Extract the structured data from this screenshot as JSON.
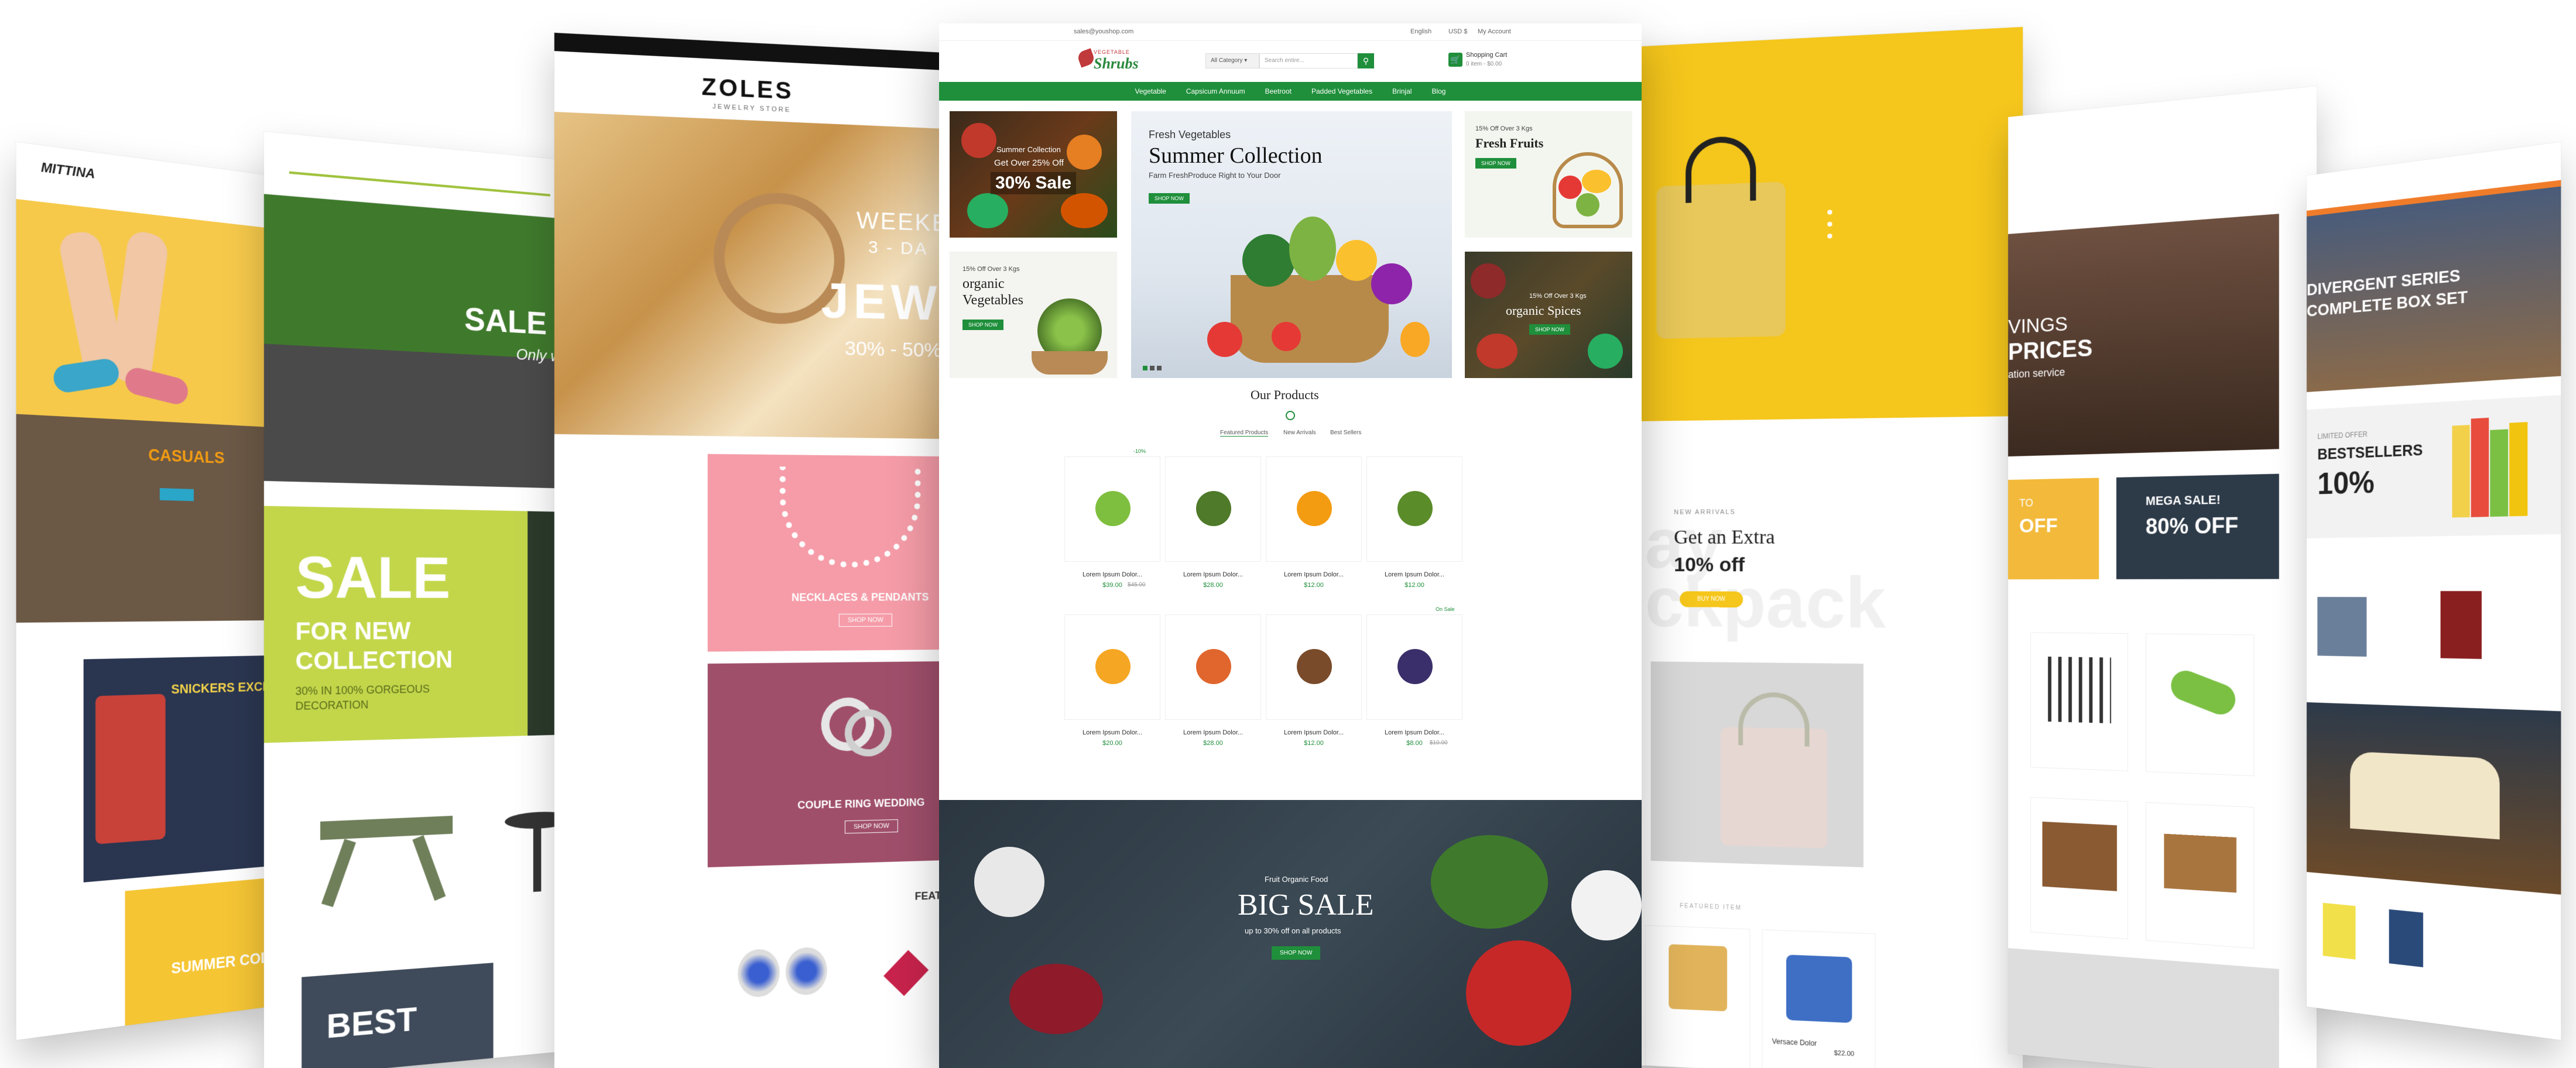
{
  "center": {
    "topbar": {
      "email": "sales@youshop.com",
      "language": "English",
      "currency": "USD $",
      "account": "My Account"
    },
    "logo": {
      "line1": "VEGETABLE",
      "line2": "Shrubs"
    },
    "search": {
      "category": "All Category",
      "placeholder": "Search entire..."
    },
    "cart": {
      "title": "Shopping Cart",
      "subtitle": "0 item - $0.00"
    },
    "nav": [
      "Vegetable",
      "Capsicum Annuum",
      "Beetroot",
      "Padded Vegetables",
      "Brinjal",
      "Blog"
    ],
    "promo_left_top": {
      "line1": "Summer Collection",
      "line2": "Get Over 25% Off",
      "line3": "30% Sale"
    },
    "promo_left_bottom": {
      "line1": "15% Off Over 3 Kgs",
      "line2": "organic",
      "line3": "Vegetables",
      "button": "SHOP NOW"
    },
    "hero": {
      "kicker": "Fresh Vegetables",
      "title": "Summer Collection",
      "subtitle": "Farm FreshProduce Right to Your Door",
      "button": "SHOP NOW"
    },
    "promo_right_top": {
      "line1": "15% Off Over 3 Kgs",
      "line2": "Fresh Fruits",
      "button": "SHOP NOW"
    },
    "promo_right_bottom": {
      "line1": "15% Off Over 3 Kgs",
      "line2": "organic Spices",
      "button": "SHOP NOW"
    },
    "products": {
      "title": "Our Products",
      "tabs": [
        "Featured Products",
        "New Arrivals",
        "Best Sellers"
      ],
      "items": [
        {
          "name": "Lorem Ipsum Dolor...",
          "price": "$39.00",
          "old": "$45.00",
          "badge": "-10%",
          "color": "#7fbf3f"
        },
        {
          "name": "Lorem Ipsum Dolor...",
          "price": "$28.00",
          "old": "",
          "badge": "",
          "color": "#4f7a2a"
        },
        {
          "name": "Lorem Ipsum Dolor...",
          "price": "$12.00",
          "old": "",
          "badge": "",
          "color": "#f39c12"
        },
        {
          "name": "Lorem Ipsum Dolor...",
          "price": "$12.00",
          "old": "",
          "badge": "",
          "color": "#5b8c2a"
        },
        {
          "name": "Lorem Ipsum Dolor...",
          "price": "$20.00",
          "old": "",
          "badge": "",
          "color": "#f5a623"
        },
        {
          "name": "Lorem Ipsum Dolor...",
          "price": "$28.00",
          "old": "",
          "badge": "",
          "color": "#e0662e"
        },
        {
          "name": "Lorem Ipsum Dolor...",
          "price": "$12.00",
          "old": "",
          "badge": "",
          "color": "#7a4b2a"
        },
        {
          "name": "Lorem Ipsum Dolor...",
          "price": "$8.00",
          "old": "$10.00",
          "badge": "On Sale",
          "color": "#3b2f6b"
        }
      ]
    },
    "banner": {
      "kicker": "Fruit Organic Food",
      "title": "BIG SALE",
      "subtitle": "up to 30% off on all products",
      "button": "SHOP NOW"
    }
  },
  "p1": {
    "logo": "MITTINA",
    "promo": "CASUALS",
    "promo2": "SNICKERS EXCLUSIVES",
    "promo3": "SUMMER COLLECTION"
  },
  "p2": {
    "hero": "SALE U",
    "hero_sub": "Only w",
    "sale_title": "SALE",
    "sale_sub1": "FOR NEW",
    "sale_sub2": "COLLECTION",
    "sale_sub3": "30% IN 100% GORGEOUS",
    "sale_sub4": "DECORATION",
    "best": "BEST"
  },
  "p3": {
    "logo": "ZOLES",
    "logo_sub": "JEWELRY STORE",
    "hero1": "WEEKEN",
    "hero2": "3 - DA",
    "hero3": "JEW",
    "hero4": "30% - 50%",
    "cat1": "NECKLACES & PENDANTS",
    "cat1_btn": "SHOP NOW",
    "cat2": "COUPLE RING WEDDING",
    "cat2_btn": "SHOP NOW",
    "feat": "FEAT"
  },
  "p5": {
    "kicker": "NEW ARRIVALS",
    "title": "Get an Extra",
    "title2": "10% off",
    "ghost": "ckpack",
    "ghost2": "ay",
    "btn": "BUY NOW",
    "section": "FEATURED ITEM",
    "item_name": "Versace Dolor",
    "item_price": "$22.00"
  },
  "p6": {
    "hero1": "VINGS",
    "hero2": "PRICES",
    "hero3": "ation service",
    "promo1": "TO",
    "promo1b": "OFF",
    "promo2": "MEGA SALE!",
    "promo2b": "80% OFF"
  },
  "p7": {
    "hero1": "DIVERGENT SERIES",
    "hero2": "COMPLETE BOX SET",
    "promo_small": "LIMITED OFFER",
    "promo": "BESTSELLERS",
    "promo_pct": "10%"
  }
}
